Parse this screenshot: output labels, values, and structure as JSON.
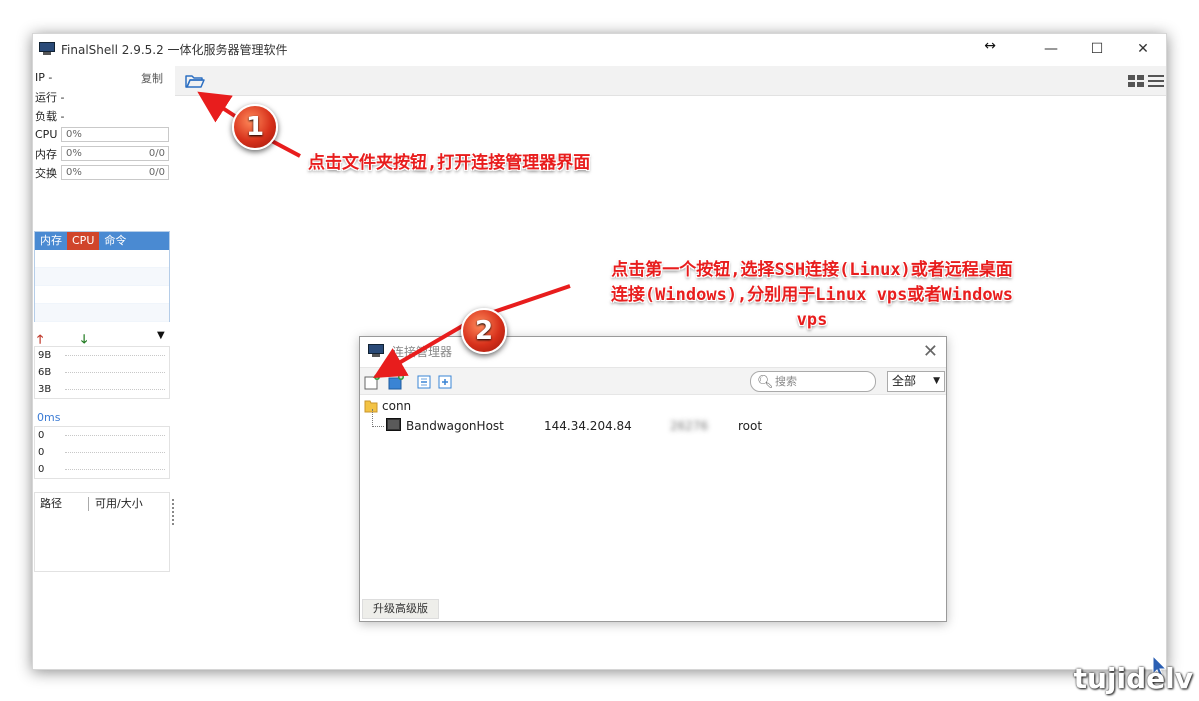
{
  "window": {
    "title": "FinalShell 2.9.5.2 一体化服务器管理软件",
    "controls": [
      "minimize",
      "maximize",
      "close"
    ]
  },
  "sidebar": {
    "ip_label": "IP -",
    "copy_label": "复制",
    "running_label": "运行 -",
    "load_label": "负载 -",
    "cpu_label": "CPU",
    "cpu_value": "0%",
    "mem_label": "内存",
    "mem_value": "0%",
    "mem_ratio": "0/0",
    "swap_label": "交换",
    "swap_value": "0%",
    "swap_ratio": "0/0",
    "process_tabs": [
      "内存",
      "CPU",
      "命令"
    ],
    "net_ticks": [
      "9B",
      "6B",
      "3B"
    ],
    "latency_label": "0ms",
    "latency_ticks": [
      "0",
      "0",
      "0"
    ],
    "fs_headers": [
      "路径",
      "可用/大小"
    ]
  },
  "dialog": {
    "title": "连接管理器",
    "search_placeholder": "搜索",
    "filter_value": "全部",
    "folder_name": "conn",
    "connection": {
      "name": "BandwagonHost",
      "host": "144.34.204.84",
      "port": "26276",
      "user": "root"
    },
    "upgrade_button": "升级高级版"
  },
  "annotations": {
    "step1_number": "1",
    "step1_text": "点击文件夹按钮,打开连接管理器界面",
    "step2_number": "2",
    "step2_line1": "点击第一个按钮,选择SSH连接(Linux)或者远程桌面",
    "step2_line2": "连接(Windows),分别用于Linux vps或者Windows",
    "step2_line3": "vps"
  },
  "watermark": "tujidelv",
  "colors": {
    "annotation_red": "#e81d1d",
    "process_header_blue": "#4a8ad2",
    "process_active_red": "#d0452b",
    "latency_blue": "#3b7bd4"
  }
}
